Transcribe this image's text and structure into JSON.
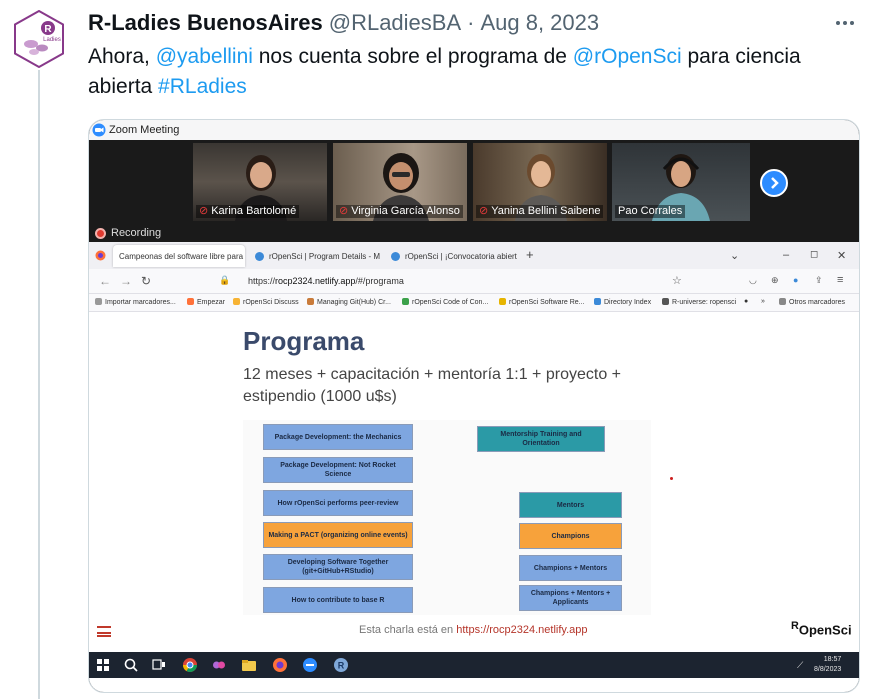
{
  "tweet": {
    "author_name": "R-Ladies BuenosAires",
    "handle": "@RLadiesBA",
    "separator": "·",
    "date": "Aug 8, 2023",
    "text_1": "Ahora, ",
    "mention_1": "@yabellini",
    "text_2": " nos cuenta sobre el programa de ",
    "mention_2": "@rOpenSci",
    "text_3": " para ciencia abierta ",
    "hashtag": "#RLadies",
    "avatar_text": "R",
    "avatar_brand": "Ladies"
  },
  "zoom": {
    "window_title": "Zoom Meeting",
    "participants": [
      {
        "name": "Karina Bartolomé",
        "muted": true
      },
      {
        "name": "Virginia García Alonso",
        "muted": true
      },
      {
        "name": "Yanina Bellini Saibene",
        "muted": true
      },
      {
        "name": "Pao Corrales",
        "muted": false
      }
    ],
    "recording_label": "Recording"
  },
  "browser": {
    "tabs": [
      {
        "label": "Campeonas del software libre para",
        "active": true
      },
      {
        "label": "rOpenSci | Program Details - M",
        "active": false
      },
      {
        "label": "rOpenSci | ¡Convocatoria abiert",
        "active": false
      }
    ],
    "new_tab": "+",
    "url_prefix": "https://",
    "url_host": "rocp2324.netlify.app",
    "url_path": "/#/programa",
    "bookmarks": [
      "Importar marcadores...",
      "Empezar",
      "rOpenSci Discuss",
      "Managing Git(Hub) Cr...",
      "rOpenSci Code of Con...",
      "rOpenSci Software Re...",
      "Directory Index",
      "R-universe: ropensci",
      "Otros marcadores"
    ]
  },
  "slide": {
    "title": "Programa",
    "subtitle": "12 meses + capacitación + mentoría 1:1 + proyecto + estipendio (1000 u$s)",
    "left_boxes": [
      "Package Development: the Mechanics",
      "Package Development: Not Rocket Science",
      "How rOpenSci performs peer-review",
      "Making a PACT (organizing online events)",
      "Developing Software Together (git+GitHub+RStudio)",
      "How to contribute to base R"
    ],
    "right_boxes": [
      "Mentorship Training and Orientation",
      "Mentors",
      "Champions",
      "Champions + Mentors",
      "Champions + Mentors + Applicants"
    ],
    "footnote_text": "Esta charla está en ",
    "footnote_link": "https://rocp2324.netlify.app",
    "logo_r": "R",
    "logo_text": "OpenSci"
  },
  "taskbar": {
    "time": "18:57",
    "date": "8/8/2023"
  },
  "colors": {
    "link": "#1d9bf0",
    "box_blue": "#7ea6e0",
    "box_orange": "#f7a23b",
    "box_teal": "#2b9aa6",
    "title_blue": "#3a4a6b"
  }
}
